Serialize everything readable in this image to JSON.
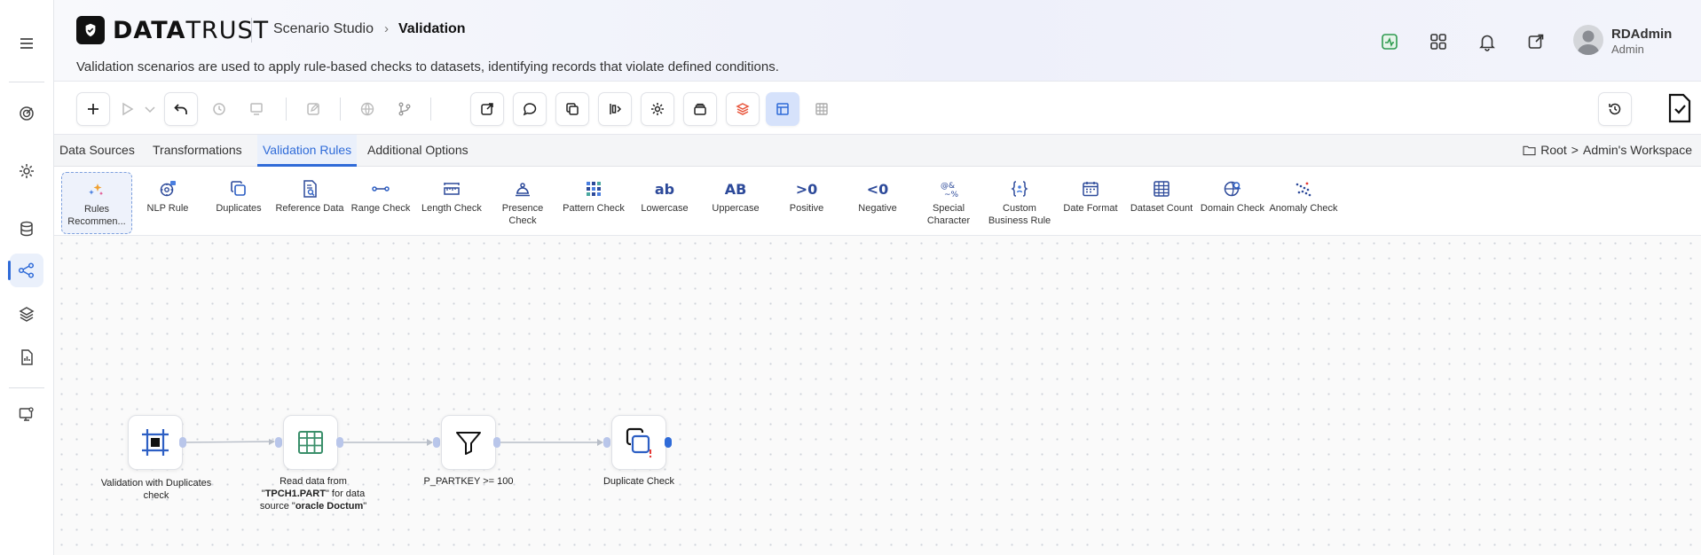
{
  "header": {
    "logo_bold": "DATA",
    "logo_light": "TRUST",
    "breadcrumb_parent": "Scenario Studio",
    "breadcrumb_current": "Validation",
    "description": "Validation scenarios are used to apply rule-based checks to datasets, identifying records that violate defined conditions.",
    "user_name": "RDAdmin",
    "user_role": "Admin"
  },
  "tabs": [
    {
      "label": "Data Sources"
    },
    {
      "label": "Transformations"
    },
    {
      "label": "Validation Rules"
    },
    {
      "label": "Additional Options"
    }
  ],
  "active_tab": "Validation Rules",
  "workspace": {
    "root": "Root",
    "separator": ">",
    "name": "Admin's Workspace"
  },
  "palette": [
    {
      "label": "Rules Recommen...",
      "icon": "sparkles-icon"
    },
    {
      "label": "NLP Rule",
      "icon": "brain-gear-icon"
    },
    {
      "label": "Duplicates",
      "icon": "duplicate-icon"
    },
    {
      "label": "Reference Data",
      "icon": "document-search-icon"
    },
    {
      "label": "Range Check",
      "icon": "range-icon"
    },
    {
      "label": "Length Check",
      "icon": "ruler-icon"
    },
    {
      "label": "Presence Check",
      "icon": "bell-presence-icon"
    },
    {
      "label": "Pattern Check",
      "icon": "grid-dots-icon"
    },
    {
      "label": "Lowercase",
      "glyph": "ab"
    },
    {
      "label": "Uppercase",
      "glyph": "AB"
    },
    {
      "label": "Positive",
      "glyph": ">0"
    },
    {
      "label": "Negative",
      "glyph": "<0"
    },
    {
      "label": "Special Character",
      "icon": "special-char-icon"
    },
    {
      "label": "Custom Business Rule",
      "icon": "braces-icon"
    },
    {
      "label": "Date Format",
      "icon": "calendar-icon"
    },
    {
      "label": "Dataset Count",
      "icon": "table-icon"
    },
    {
      "label": "Domain Check",
      "icon": "globe-search-icon"
    },
    {
      "label": "Anomaly Check",
      "icon": "scatter-icon"
    }
  ],
  "flow": {
    "nodes": [
      {
        "id": "start",
        "label": "Validation with Duplicates check"
      },
      {
        "id": "read",
        "label_prefix": "Read data from \"",
        "table": "TPCH1.PART",
        "label_mid": "\" for data source \"",
        "source": "oracle Doctum",
        "label_suffix": "\""
      },
      {
        "id": "filter",
        "label": "P_PARTKEY >= 100"
      },
      {
        "id": "dup",
        "label": "Duplicate Check"
      }
    ]
  },
  "colors": {
    "accent": "#2f6bd8",
    "node_icon": "#2d5fc4",
    "read_icon": "#3a8f6a",
    "status_green": "#2e9a4f",
    "error_red": "#e53935"
  }
}
